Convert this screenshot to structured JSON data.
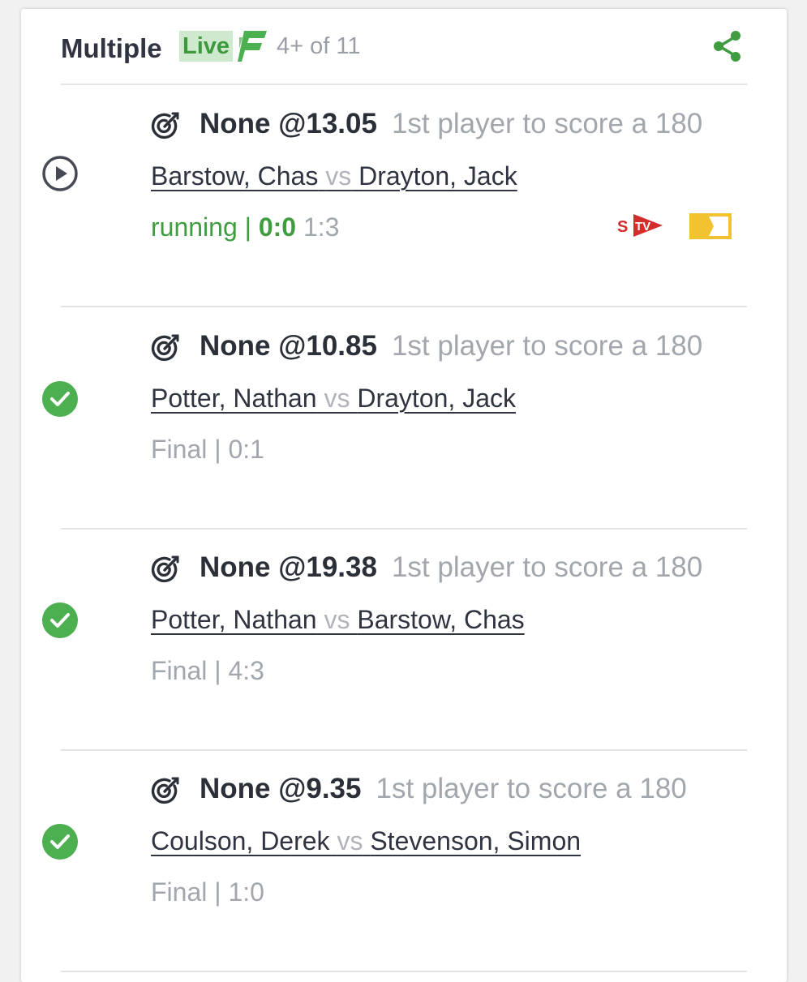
{
  "header": {
    "title": "Multiple",
    "live_label": "Live",
    "count": "4+ of 11",
    "share_icon": "share-icon",
    "brand_icon": "brand-f-logo"
  },
  "colors": {
    "accent_green": "#3f9c3f",
    "text_dark": "#2f3440",
    "text_muted": "#a2a6ad",
    "divider": "#e4e4e6",
    "ticket_yellow": "#f2c230",
    "stv_red": "#d42b2b"
  },
  "legs": [
    {
      "status": "running-play-icon",
      "selection": "None @13.05",
      "market": "1st player to score a 180",
      "player1": "Barstow, Chas",
      "vs": "vs",
      "player2": "Drayton, Jack",
      "state": "running",
      "separator": "|",
      "score": "0:0",
      "sets": "1:3",
      "stream_icon": "stv-icon",
      "ticket_icon": "ticket-icon"
    },
    {
      "status": "check-circle-icon",
      "selection": "None @10.85",
      "market": "1st player to score a 180",
      "player1": "Potter, Nathan",
      "vs": "vs",
      "player2": "Drayton, Jack",
      "result": "Final | 0:1"
    },
    {
      "status": "check-circle-icon",
      "selection": "None @19.38",
      "market": "1st player to score a 180",
      "player1": "Potter, Nathan",
      "vs": "vs",
      "player2": "Barstow, Chas",
      "result": "Final | 4:3"
    },
    {
      "status": "check-circle-icon",
      "selection": "None @9.35",
      "market": "1st player to score a 180",
      "player1": "Coulson, Derek",
      "vs": "vs",
      "player2": "Stevenson, Simon",
      "result": "Final | 1:0"
    }
  ]
}
